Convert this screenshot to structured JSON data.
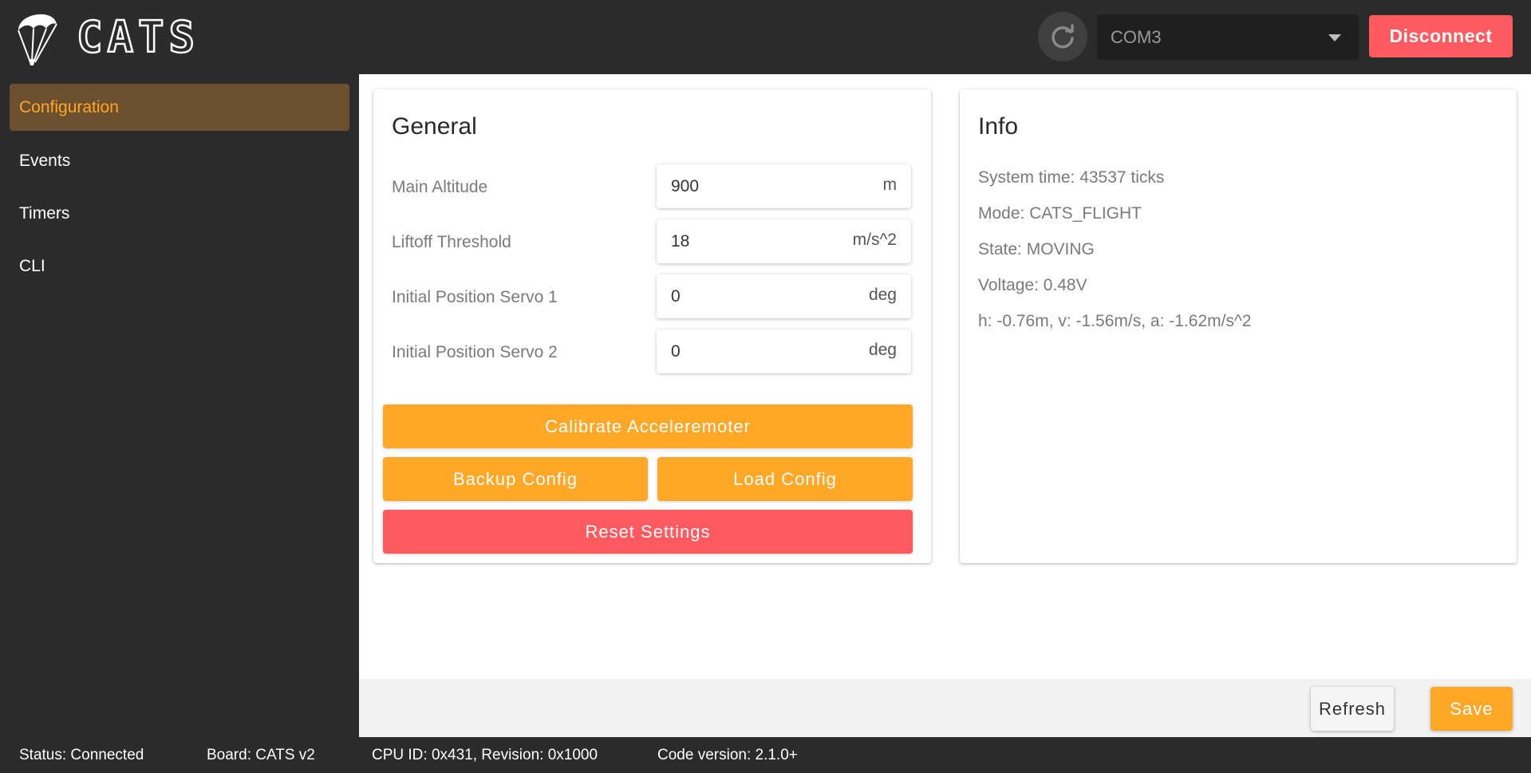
{
  "header": {
    "brand": "CATS",
    "port": {
      "selected": "COM3"
    },
    "disconnect_label": "Disconnect",
    "icons": {
      "logo": "parachute-logo",
      "refresh": "refresh-icon",
      "dropdown": "caret-down-icon"
    }
  },
  "sidebar": {
    "items": [
      {
        "label": "Configuration",
        "active": true
      },
      {
        "label": "Events",
        "active": false
      },
      {
        "label": "Timers",
        "active": false
      },
      {
        "label": "CLI",
        "active": false
      }
    ]
  },
  "general": {
    "title": "General",
    "fields": [
      {
        "label": "Main Altitude",
        "value": "900",
        "unit": "m"
      },
      {
        "label": "Liftoff Threshold",
        "value": "18",
        "unit": "m/s^2"
      },
      {
        "label": "Initial Position Servo 1",
        "value": "0",
        "unit": "deg"
      },
      {
        "label": "Initial Position Servo 2",
        "value": "0",
        "unit": "deg"
      }
    ],
    "buttons": {
      "calibrate": "Calibrate Acceleremoter",
      "backup": "Backup Config",
      "load": "Load Config",
      "reset": "Reset Settings"
    }
  },
  "info": {
    "title": "Info",
    "lines": [
      "System time: 43537 ticks",
      "Mode: CATS_FLIGHT",
      "State: MOVING",
      "Voltage: 0.48V",
      "h: -0.76m, v: -1.56m/s, a: -1.62m/s^2"
    ]
  },
  "actions": {
    "refresh_label": "Refresh",
    "save_label": "Save"
  },
  "status": {
    "status": "Status: Connected",
    "board": "Board: CATS v2",
    "cpu": "CPU ID: 0x431, Revision: 0x1000",
    "code": "Code version: 2.1.0+"
  },
  "colors": {
    "accent": "#ffa726",
    "danger": "#ff5a5f",
    "dark": "#2b2b2b",
    "active_nav_bg": "#6b4f2e"
  }
}
